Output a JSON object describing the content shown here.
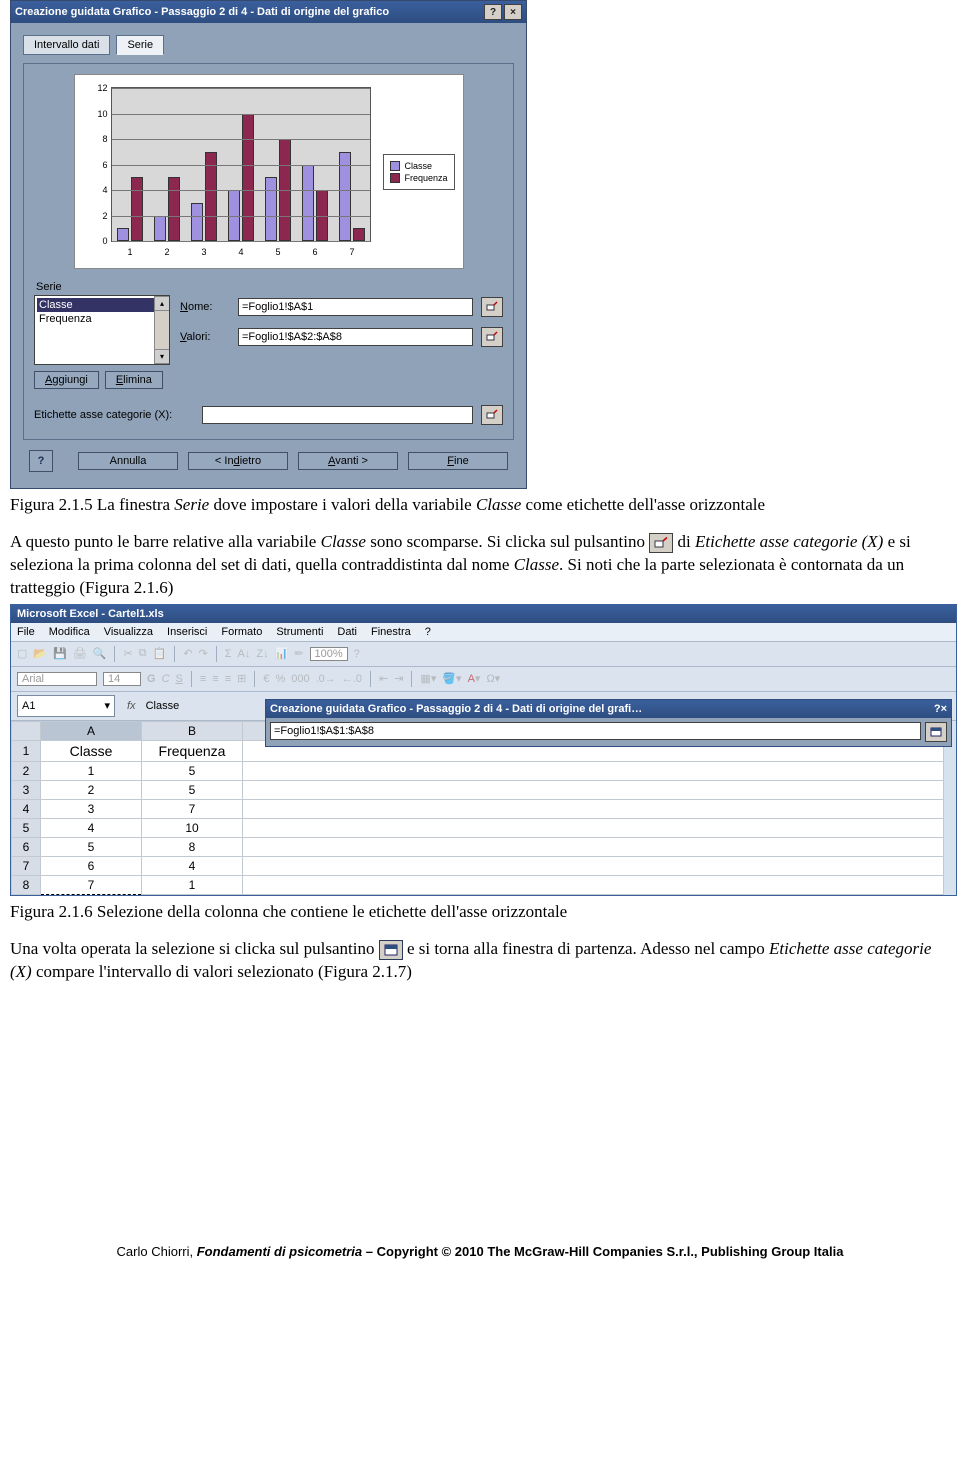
{
  "dialog": {
    "title": "Creazione guidata Grafico - Passaggio 2 di 4 - Dati di origine del grafico",
    "tabs": {
      "data_range": "Intervallo dati",
      "series": "Serie"
    },
    "series_label": "Serie",
    "series_list": [
      "Classe",
      "Frequenza"
    ],
    "add_btn": "Aggiungi",
    "del_btn": "Elimina",
    "name_label": "Nome:",
    "values_label": "Valori:",
    "name_value": "=Foglio1!$A$1",
    "values_value": "=Foglio1!$A$2:$A$8",
    "category_label": "Etichette asse categorie (X):",
    "category_value": "",
    "help_btn": "?",
    "cancel_btn": "Annulla",
    "back_btn": "< Indietro",
    "next_btn": "Avanti >",
    "finish_btn": "Fine",
    "legend": {
      "s1": "Classe",
      "s2": "Frequenza"
    }
  },
  "chart_data": {
    "type": "bar",
    "categories": [
      "1",
      "2",
      "3",
      "4",
      "5",
      "6",
      "7"
    ],
    "series": [
      {
        "name": "Classe",
        "values": [
          1,
          2,
          3,
          4,
          5,
          6,
          7
        ]
      },
      {
        "name": "Frequenza",
        "values": [
          5,
          5,
          7,
          10,
          8,
          4,
          1
        ]
      }
    ],
    "ylim": [
      0,
      12
    ],
    "yticks": [
      0,
      2,
      4,
      6,
      8,
      10,
      12
    ]
  },
  "text": {
    "caption1_a": "Figura 2.1.5 La finestra ",
    "caption1_b": "Serie",
    "caption1_c": " dove impostare i valori della variabile ",
    "caption1_d": "Classe",
    "caption1_e": " come etichette dell'asse orizzontale",
    "para1_a": "A questo punto le barre relative alla variabile ",
    "para1_b": "Classe",
    "para1_c": " sono scomparse. Si clicka sul pulsantino ",
    "para1_d": " di ",
    "para1_e": "Etichette asse categorie (X)",
    "para1_f": " e si seleziona la prima colonna del set di dati, quella contraddistinta dal nome ",
    "para1_g": "Classe",
    "para1_h": ". Si noti che la parte selezionata è contornata da un tratteggio (Figura 2.1.6)",
    "caption2": "Figura 2.1.6 Selezione della colonna che contiene le etichette dell'asse orizzontale",
    "para2_a": "Una volta operata la selezione si clicka sul pulsantino ",
    "para2_b": " e si torna alla finestra di partenza. Adesso nel campo ",
    "para2_c": "Etichette asse categorie (X)",
    "para2_d": " compare l'intervallo di valori selezionato (Figura 2.1.7)"
  },
  "excel": {
    "app_title": "Microsoft Excel - Cartel1.xls",
    "menus": [
      "File",
      "Modifica",
      "Visualizza",
      "Inserisci",
      "Formato",
      "Strumenti",
      "Dati",
      "Finestra",
      "?"
    ],
    "font_name": "Arial",
    "font_size": "14",
    "zoom": "100%",
    "namebox": "A1",
    "fx_label": "fx",
    "formula_value": "Classe",
    "col_headers": [
      "A",
      "B"
    ],
    "row_headers": [
      "1",
      "2",
      "3",
      "4",
      "5",
      "6",
      "7",
      "8"
    ],
    "data_headers": [
      "Classe",
      "Frequenza"
    ],
    "data_rows": [
      [
        "1",
        "5"
      ],
      [
        "2",
        "5"
      ],
      [
        "3",
        "7"
      ],
      [
        "4",
        "10"
      ],
      [
        "5",
        "8"
      ],
      [
        "6",
        "4"
      ],
      [
        "7",
        "1"
      ]
    ],
    "collapsed": {
      "title": "Creazione guidata Grafico - Passaggio 2 di 4 - Dati di origine del grafi…",
      "value": "=Foglio1!$A$1:$A$8"
    }
  },
  "footer": {
    "author": "Carlo Chiorri, ",
    "book": "Fondamenti di psicometria",
    "rest": " – Copyright © 2010 The McGraw-Hill Companies S.r.l., Publishing Group Italia"
  }
}
